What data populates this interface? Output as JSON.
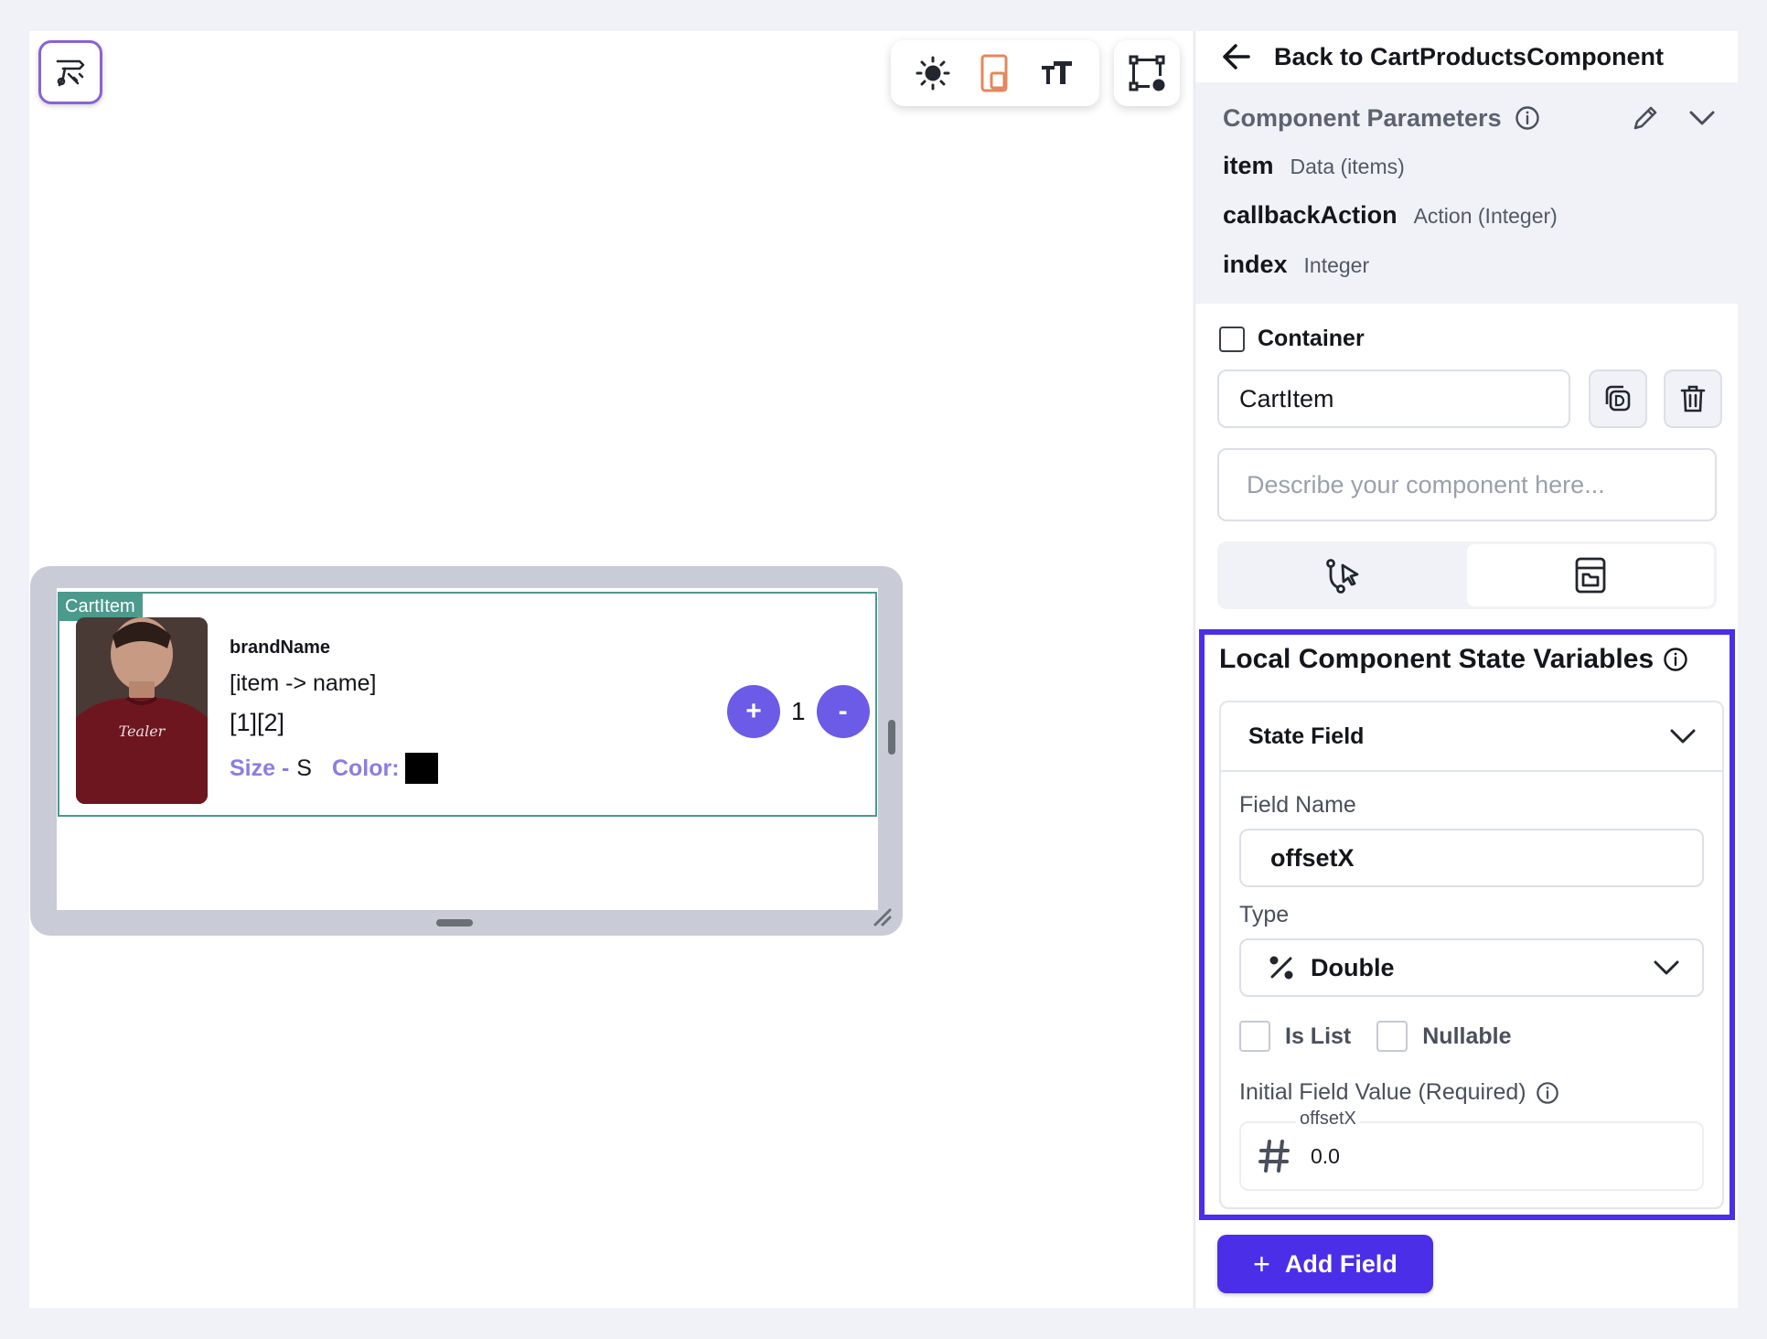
{
  "canvas": {
    "preview": {
      "tag": "CartItem",
      "brand": "brandName",
      "item_name": "[item -> name]",
      "variant": "[1][2]",
      "size_label": "Size -",
      "size_value": "S",
      "color_label": "Color:",
      "color_value": "#000000",
      "plus_label": "+",
      "quantity": "1",
      "minus_label": "-"
    }
  },
  "panel": {
    "back_label": "Back to CartProductsComponent",
    "params_title": "Component Parameters",
    "params": [
      {
        "name": "item",
        "type": "Data (items)"
      },
      {
        "name": "callbackAction",
        "type": "Action (Integer)"
      },
      {
        "name": "index",
        "type": "Integer"
      }
    ],
    "container_label": "Container",
    "component_name": "CartItem",
    "description_placeholder": "Describe your component here...",
    "state": {
      "title": "Local Component State Variables",
      "card_title": "State Field",
      "field_name_label": "Field Name",
      "field_name_value": "offsetX",
      "type_label": "Type",
      "type_value": "Double",
      "is_list_label": "Is List",
      "nullable_label": "Nullable",
      "initial_label": "Initial Field Value (Required)",
      "initial_float": "offsetX",
      "initial_value": "0.0"
    },
    "add_field_label": "Add Field"
  },
  "colors": {
    "accent": "#4b2ee8",
    "button_purple": "#6b5be6",
    "tag_green": "#4b9a8c",
    "label_purple": "#8a7ee2"
  }
}
